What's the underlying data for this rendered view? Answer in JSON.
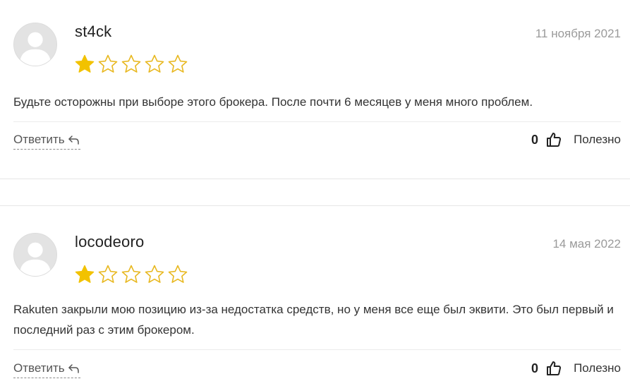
{
  "reviews": [
    {
      "author": "st4ck",
      "date": "11 ноября 2021",
      "rating": 1,
      "max_rating": 5,
      "text": "Будьте осторожны при выборе этого брокера. После почти 6 месяцев у меня много проблем.",
      "reply_label": "Ответить",
      "helpful_count": "0",
      "helpful_label": "Полезно"
    },
    {
      "author": "locodeoro",
      "date": "14 мая 2022",
      "rating": 1,
      "max_rating": 5,
      "text": "Rakuten закрыли мою позицию из-за недостатка средств, но у меня все еще был эквити. Это был первый и последний раз с этим брокером.",
      "reply_label": "Ответить",
      "helpful_count": "0",
      "helpful_label": "Полезно"
    }
  ],
  "colors": {
    "star_filled": "#f2c200",
    "star_outline": "#e8b820",
    "date": "#9a9a9a",
    "divider": "#ececec"
  },
  "icons": {
    "avatar": "avatar-placeholder-icon",
    "star": "star-icon",
    "reply": "reply-arrow-icon",
    "thumb": "thumbs-up-icon"
  }
}
